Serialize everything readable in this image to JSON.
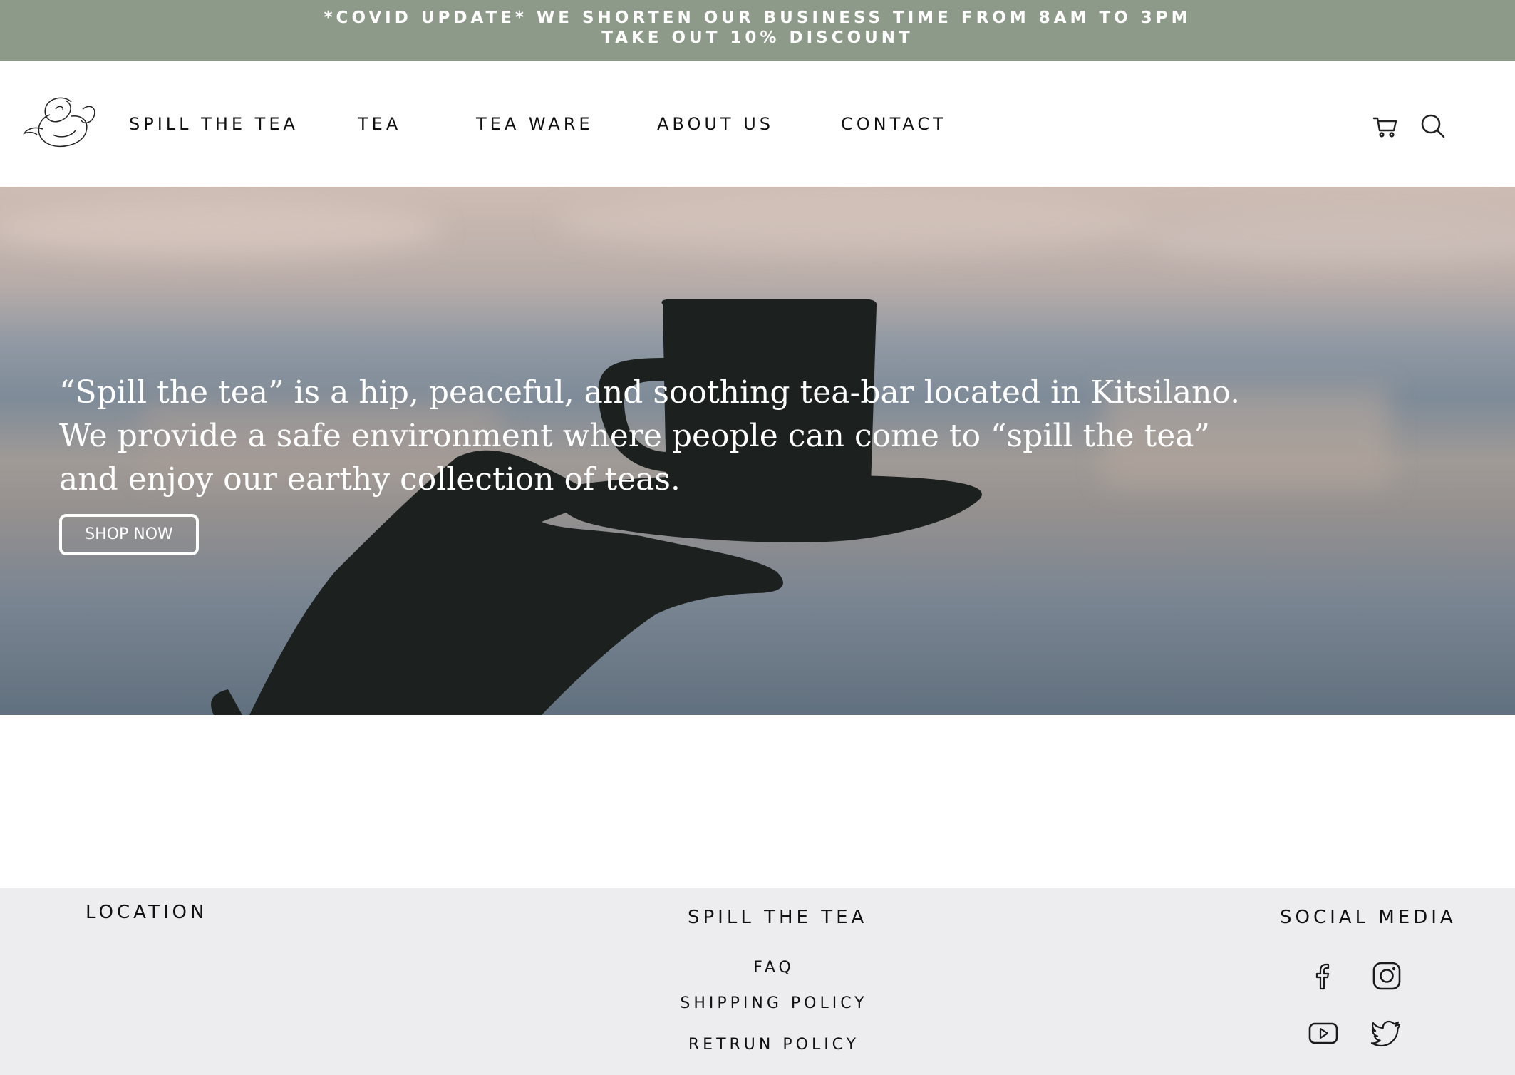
{
  "announcement": {
    "line1": "*COVID UPDATE* WE SHORTEN OUR BUSINESS TIME FROM 8AM TO 3PM",
    "line2": "TAKE OUT 10% DISCOUNT"
  },
  "nav": {
    "logo": "teapot-logo",
    "links": [
      "SPILL THE TEA",
      "TEA",
      "TEA WARE",
      "ABOUT US",
      "CONTACT"
    ],
    "icons": [
      "cart-icon",
      "search-icon"
    ]
  },
  "hero": {
    "lines": [
      "“Spill the tea” is a hip, peaceful, and soothing tea-bar located in Kitsilano.",
      "We provide a safe environment where people can come to “spill the tea”",
      "and enjoy our earthy collection of teas."
    ],
    "button": "SHOP NOW"
  },
  "footer": {
    "location_heading": "LOCATION",
    "brand_heading": "SPILL THE TEA",
    "social_heading": "SOCIAL MEDIA",
    "links": [
      "FAQ",
      "SHIPPING POLICY",
      "RETRUN POLICY"
    ],
    "social_icons": [
      "facebook-icon",
      "instagram-icon",
      "youtube-icon",
      "twitter-icon"
    ]
  },
  "colors": {
    "banner": "#8e9a89",
    "footer": "#ededf0",
    "text": "#111111"
  }
}
